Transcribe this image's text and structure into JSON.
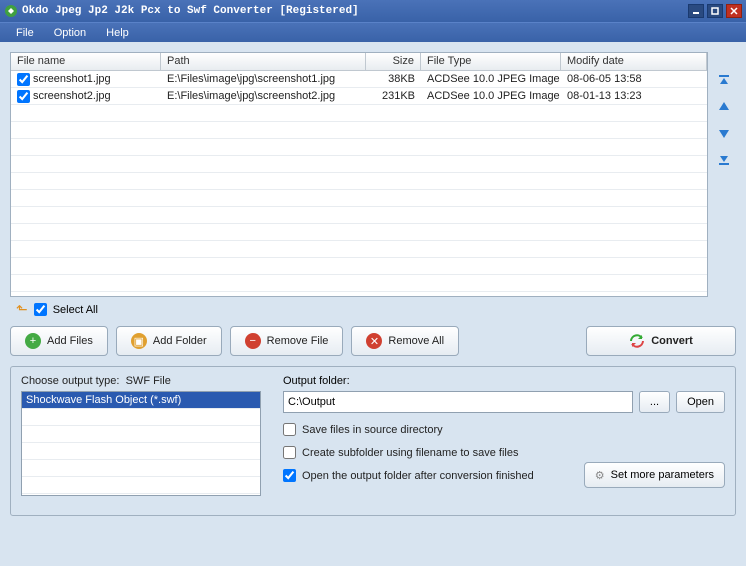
{
  "titlebar": {
    "text": "Okdo Jpeg Jp2 J2k Pcx to Swf Converter [Registered]"
  },
  "menu": {
    "file": "File",
    "option": "Option",
    "help": "Help"
  },
  "columns": {
    "name": "File name",
    "path": "Path",
    "size": "Size",
    "type": "File Type",
    "date": "Modify date"
  },
  "rows": [
    {
      "name": "screenshot1.jpg",
      "path": "E:\\Files\\image\\jpg\\screenshot1.jpg",
      "size": "38KB",
      "type": "ACDSee 10.0 JPEG Image",
      "date": "08-06-05 13:58"
    },
    {
      "name": "screenshot2.jpg",
      "path": "E:\\Files\\image\\jpg\\screenshot2.jpg",
      "size": "231KB",
      "type": "ACDSee 10.0 JPEG Image",
      "date": "08-01-13 13:23"
    }
  ],
  "select_all": "Select All",
  "buttons": {
    "add_files": "Add Files",
    "add_folder": "Add Folder",
    "remove_file": "Remove File",
    "remove_all": "Remove All",
    "convert": "Convert"
  },
  "output_type": {
    "label_prefix": "Choose output type:",
    "label_value": "SWF File",
    "option": "Shockwave Flash Object (*.swf)"
  },
  "output": {
    "label": "Output folder:",
    "path": "C:\\Output",
    "browse": "...",
    "open": "Open",
    "save_src": "Save files in source directory",
    "subfolder": "Create subfolder using filename to save files",
    "open_after": "Open the output folder after conversion finished",
    "more_params": "Set more parameters"
  }
}
